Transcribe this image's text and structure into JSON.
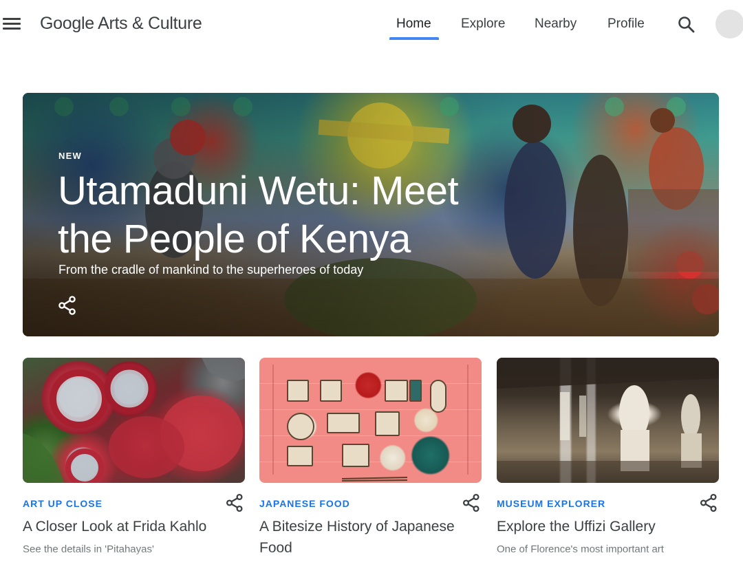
{
  "header": {
    "logo": "Google Arts & Culture",
    "nav": {
      "home": "Home",
      "explore": "Explore",
      "nearby": "Nearby",
      "profile": "Profile"
    },
    "active_tab": "Home",
    "accent_color": "#4285f4"
  },
  "hero": {
    "tag": "NEW",
    "title": "Utamaduni Wetu: Meet the People of Kenya",
    "subtitle": "From the cradle of mankind to the superheroes of today",
    "share_icon": "share-icon"
  },
  "cards": [
    {
      "category": "ART UP CLOSE",
      "title": "A Closer Look at Frida Kahlo",
      "description": "See the details in 'Pitahayas'"
    },
    {
      "category": "JAPANESE FOOD",
      "title": "A Bitesize History of Japanese Food",
      "description": ""
    },
    {
      "category": "MUSEUM EXPLORER",
      "title": "Explore the Uffizi Gallery",
      "description": "One of Florence's most important art museums"
    }
  ],
  "colors": {
    "category_blue": "#1a73e8",
    "text_dark": "#3c4043",
    "text_muted": "#70757a"
  }
}
